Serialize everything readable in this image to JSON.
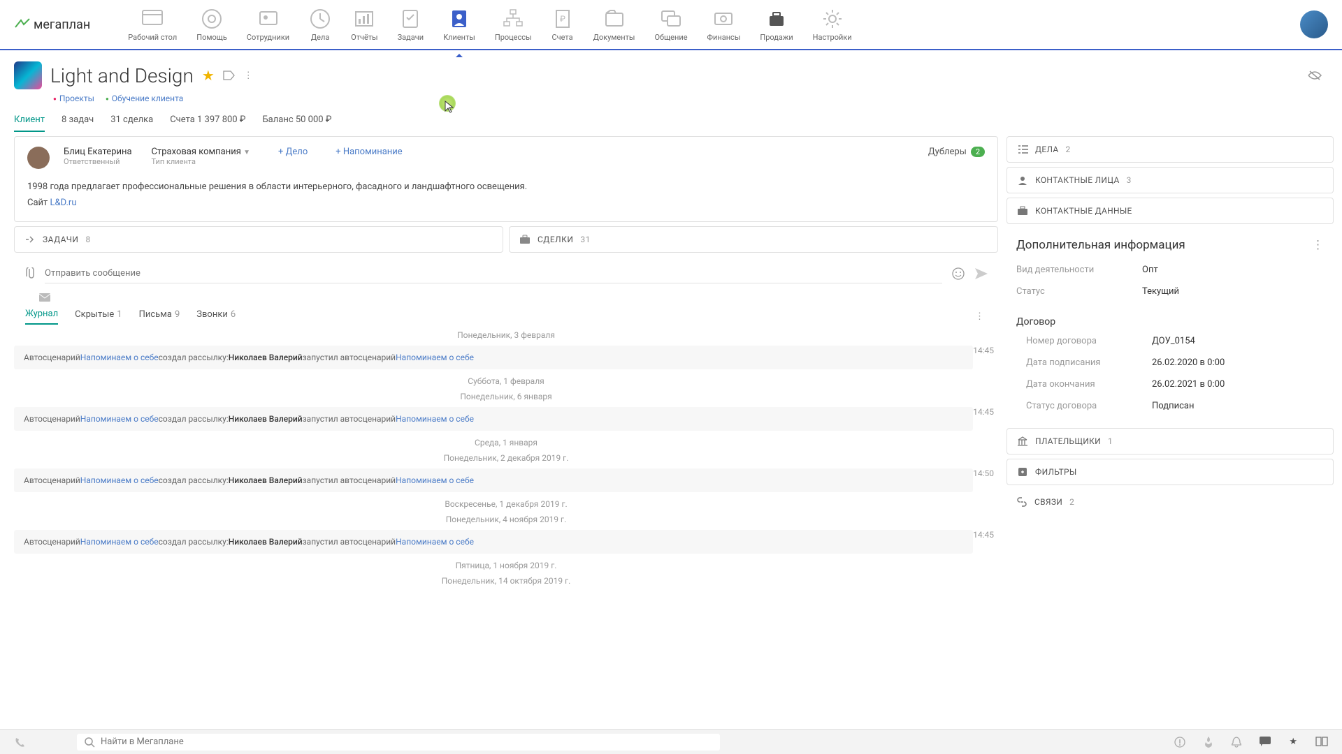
{
  "logo_text": "мегаплан",
  "nav": [
    {
      "id": "desktop",
      "label": "Рабочий стол"
    },
    {
      "id": "help",
      "label": "Помощь"
    },
    {
      "id": "staff",
      "label": "Сотрудники"
    },
    {
      "id": "tasks",
      "label": "Дела"
    },
    {
      "id": "reports",
      "label": "Отчёты"
    },
    {
      "id": "todo",
      "label": "Задачи"
    },
    {
      "id": "clients",
      "label": "Клиенты",
      "active": true
    },
    {
      "id": "processes",
      "label": "Процессы"
    },
    {
      "id": "invoices",
      "label": "Счета"
    },
    {
      "id": "docs",
      "label": "Документы"
    },
    {
      "id": "chat",
      "label": "Общение"
    },
    {
      "id": "finance",
      "label": "Финансы"
    },
    {
      "id": "sales",
      "label": "Продажи"
    },
    {
      "id": "settings",
      "label": "Настройки"
    }
  ],
  "client": {
    "title": "Light and Design",
    "breadcrumbs": [
      "Проекты",
      "Обучение клиента"
    ],
    "tabs": [
      {
        "label": "Клиент",
        "active": true
      },
      {
        "label": "8 задач"
      },
      {
        "label": "31 сделка"
      },
      {
        "label": "Счета 1 397 800 ₽"
      },
      {
        "label": "Баланс 50 000 ₽"
      }
    ],
    "responsible": {
      "name": "Блиц Екатерина",
      "role": "Ответственный"
    },
    "client_type": {
      "value": "Страховая компания",
      "label": "Тип клиента"
    },
    "actions": {
      "add_task": "+ Дело",
      "add_reminder": "+ Напоминание"
    },
    "duplicates": {
      "label": "Дублеры",
      "count": "2"
    },
    "description_line1": "1998 года предлагает профессиональные решения в области интерьерного, фасадного и ландшафтного освещения.",
    "description_site_prefix": "Сайт ",
    "description_site": "L&D.ru",
    "cards": {
      "tasks": {
        "label": "ЗАДАЧИ",
        "count": "8"
      },
      "deals": {
        "label": "СДЕЛКИ",
        "count": "31"
      }
    },
    "compose_placeholder": "Отправить сообщение",
    "journal_tabs": [
      {
        "label": "Журнал",
        "active": true
      },
      {
        "label": "Скрытые",
        "count": "1"
      },
      {
        "label": "Письма",
        "count": "9"
      },
      {
        "label": "Звонки",
        "count": "6"
      }
    ]
  },
  "feed": {
    "groups": [
      {
        "date": "Понедельник, 3 февраля",
        "rows": [
          {
            "time": "14:45"
          }
        ],
        "extra_dates": []
      },
      {
        "date": "Суббота, 1 февраля",
        "rows": [],
        "extra_dates": [
          "Понедельник, 6 января"
        ]
      },
      {
        "date": "",
        "rows": [
          {
            "time": "14:45"
          }
        ],
        "extra_dates": [
          "Среда, 1 января",
          "Понедельник, 2 декабря 2019 г."
        ]
      },
      {
        "date": "",
        "rows": [
          {
            "time": "14:50"
          }
        ],
        "extra_dates": [
          "Воскресенье, 1 декабря 2019 г.",
          "Понедельник, 4 ноября 2019 г."
        ]
      },
      {
        "date": "",
        "rows": [
          {
            "time": "14:45"
          }
        ],
        "extra_dates": [
          "Пятница, 1 ноября 2019 г.",
          "Понедельник, 14 октября 2019 г."
        ]
      }
    ],
    "row_template": {
      "prefix": "Автосценарий ",
      "link1": "Напоминаем о себе",
      "mid1": " создал рассылку:",
      "name": "Николаев Валерий",
      "mid2": " запустил автосценарий ",
      "link2": "Напоминаем о себе"
    }
  },
  "right": {
    "cards": [
      {
        "icon": "list",
        "label": "ДЕЛА",
        "count": "2"
      },
      {
        "icon": "people",
        "label": "КОНТАКТНЫЕ ЛИЦА",
        "count": "3"
      },
      {
        "icon": "briefcase",
        "label": "КОНТАКТНЫЕ ДАННЫЕ"
      }
    ],
    "extra_title": "Дополнительная информация",
    "fields": [
      {
        "label": "Вид деятельности",
        "value": "Опт"
      },
      {
        "label": "Статус",
        "value": "Текущий"
      }
    ],
    "contract": {
      "title": "Договор",
      "fields": [
        {
          "label": "Номер договора",
          "value": "ДОУ_0154"
        },
        {
          "label": "Дата подписания",
          "value": "26.02.2020 в 0:00"
        },
        {
          "label": "Дата окончания",
          "value": "26.02.2021 в 0:00"
        },
        {
          "label": "Статус договора",
          "value": "Подписан"
        }
      ]
    },
    "cards2": [
      {
        "icon": "bank",
        "label": "ПЛАТЕЛЬЩИКИ",
        "count": "1"
      },
      {
        "icon": "filter",
        "label": "ФИЛЬТРЫ"
      },
      {
        "icon": "link",
        "label": "СВЯЗИ",
        "count": "2",
        "flat": true
      }
    ]
  },
  "footer": {
    "search_placeholder": "Найти в Мегаплане"
  }
}
